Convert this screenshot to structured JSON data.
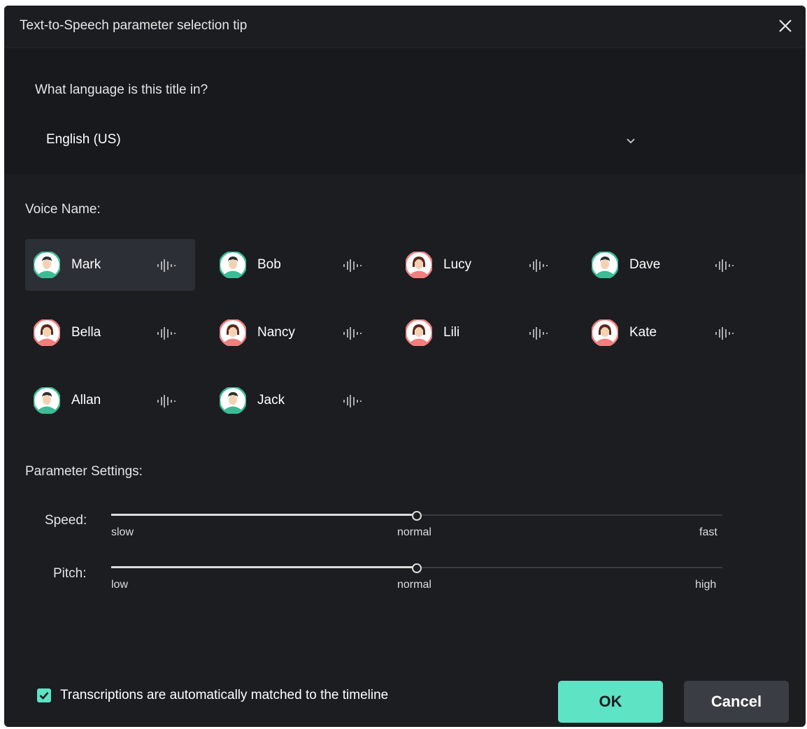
{
  "dialog": {
    "title": "Text-to-Speech parameter selection tip",
    "close_icon": "close-icon"
  },
  "language": {
    "question": "What language is this title in?",
    "selected": "English (US)"
  },
  "voices": {
    "label": "Voice Name:",
    "items": [
      {
        "name": "Mark",
        "gender": "male",
        "selected": true
      },
      {
        "name": "Bob",
        "gender": "male"
      },
      {
        "name": "Lucy",
        "gender": "female"
      },
      {
        "name": "Dave",
        "gender": "male"
      },
      {
        "name": "Bella",
        "gender": "female"
      },
      {
        "name": "Nancy",
        "gender": "female"
      },
      {
        "name": "Lili",
        "gender": "female"
      },
      {
        "name": "Kate",
        "gender": "female"
      },
      {
        "name": "Allan",
        "gender": "male"
      },
      {
        "name": "Jack",
        "gender": "male"
      }
    ]
  },
  "parameters": {
    "label": "Parameter Settings:",
    "speed": {
      "label": "Speed:",
      "min": "slow",
      "mid": "normal",
      "max": "fast",
      "value": 0.5
    },
    "pitch": {
      "label": "Pitch:",
      "min": "low",
      "mid": "normal",
      "max": "high",
      "value": 0.5
    }
  },
  "footer": {
    "checkbox_label": "Transcriptions are automatically matched to the timeline",
    "checked": true,
    "ok": "OK",
    "cancel": "Cancel"
  },
  "colors": {
    "accent": "#5ee3c4",
    "male_avatar": "#3dbb95",
    "female_avatar": "#f27e7e",
    "background": "#1b1d21"
  }
}
